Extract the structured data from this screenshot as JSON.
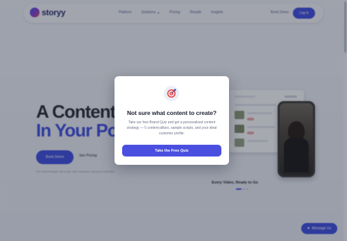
{
  "nav": {
    "brand": "storyy",
    "links": [
      {
        "label": "Platform",
        "has_dropdown": false
      },
      {
        "label": "Solutions",
        "has_dropdown": true
      },
      {
        "label": "Pricing",
        "has_dropdown": false
      },
      {
        "label": "Results",
        "has_dropdown": false
      },
      {
        "label": "Insights",
        "has_dropdown": false
      }
    ],
    "book_demo": "Book Demo",
    "login": "Log in"
  },
  "hero": {
    "title_line1": "A Content",
    "title_line2": "In Your Po",
    "primary_button": "Book Demo",
    "secondary_button": "See Pricing",
    "subtext": "You need footage. We script, edit, schedule, and post every film."
  },
  "showcase": {
    "caption": "Every Video, Ready to Go",
    "carousel_dots": 3,
    "active_dot": 0
  },
  "chat_button": {
    "label": "Message Us",
    "icon": "chat-bubble-icon"
  },
  "modal": {
    "icon": "target-icon",
    "title": "Not sure what content to create?",
    "body": "Take our free Brand Quiz and get a personalized content strategy — 5 content pillars, sample scripts, and your ideal customer profile.",
    "cta": "Take the Free Quiz"
  },
  "colors": {
    "accent": "#3f4fe0",
    "modal_button": "#4a4fe0",
    "target_red": "#e5484d",
    "overlay": "rgba(20,24,40,0.36)"
  }
}
